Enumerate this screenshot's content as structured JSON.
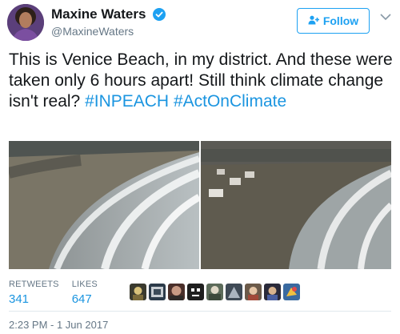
{
  "user": {
    "display_name": "Maxine Waters",
    "handle": "@MaxineWaters",
    "verified": true,
    "avatar_icon": "user-avatar"
  },
  "follow_label": "Follow",
  "tweet": {
    "text_plain": "This is Venice Beach, in my district. And these were taken only 6 hours apart! Still think climate change isn't real? ",
    "hashtag_1": "#INPEACH",
    "hashtag_2": "#ActOnClimate"
  },
  "stats": {
    "retweets_label": "RETWEETS",
    "retweets_value": "341",
    "likes_label": "LIKES",
    "likes_value": "647"
  },
  "timestamp": "2:23 PM - 1 Jun 2017",
  "colors": {
    "accent": "#1da1f2",
    "link": "#1b95e0",
    "muted": "#657786",
    "text": "#14171a"
  }
}
